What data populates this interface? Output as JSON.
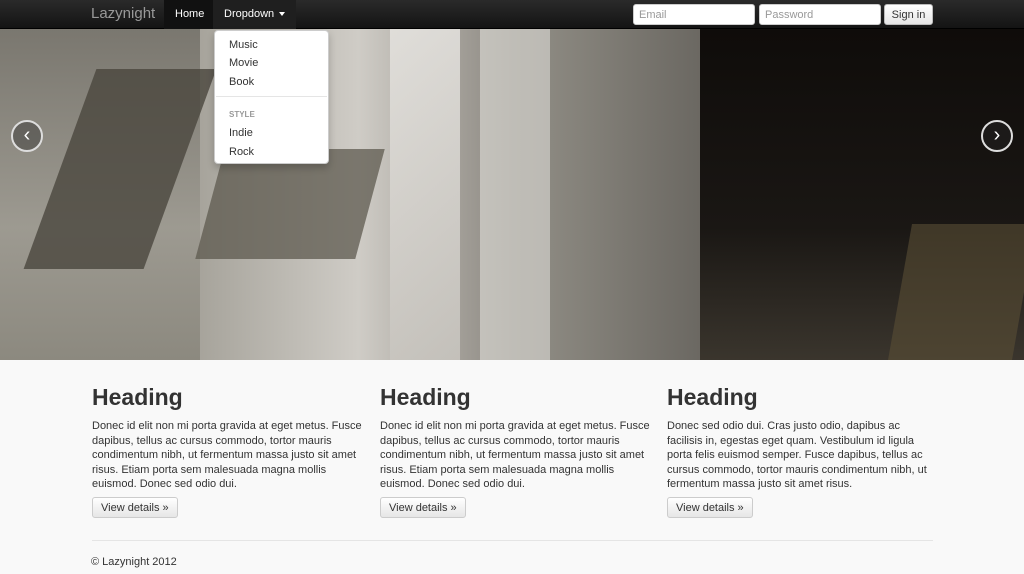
{
  "navbar": {
    "brand": "Lazynight",
    "home_label": "Home",
    "dropdown_label": "Dropdown",
    "email_placeholder": "Email",
    "password_placeholder": "Password",
    "signin_label": "Sign in"
  },
  "dropdown": {
    "items": [
      "Music",
      "Movie",
      "Book"
    ],
    "header": "STYLE",
    "style_items": [
      "Indie",
      "Rock"
    ]
  },
  "carousel": {
    "prev_glyph": "‹",
    "next_glyph": "›"
  },
  "columns": [
    {
      "heading": "Heading",
      "text": "Donec id elit non mi porta gravida at eget metus. Fusce dapibus, tellus ac cursus commodo, tortor mauris condimentum nibh, ut fermentum massa justo sit amet risus. Etiam porta sem malesuada magna mollis euismod. Donec sed odio dui.",
      "button": "View details »"
    },
    {
      "heading": "Heading",
      "text": "Donec id elit non mi porta gravida at eget metus. Fusce dapibus, tellus ac cursus commodo, tortor mauris condimentum nibh, ut fermentum massa justo sit amet risus. Etiam porta sem malesuada magna mollis euismod. Donec sed odio dui.",
      "button": "View details »"
    },
    {
      "heading": "Heading",
      "text": "Donec sed odio dui. Cras justo odio, dapibus ac facilisis in, egestas eget quam. Vestibulum id ligula porta felis euismod semper. Fusce dapibus, tellus ac cursus commodo, tortor mauris condimentum nibh, ut fermentum massa justo sit amet risus.",
      "button": "View details »"
    }
  ],
  "footer": {
    "text": "© Lazynight 2012"
  }
}
